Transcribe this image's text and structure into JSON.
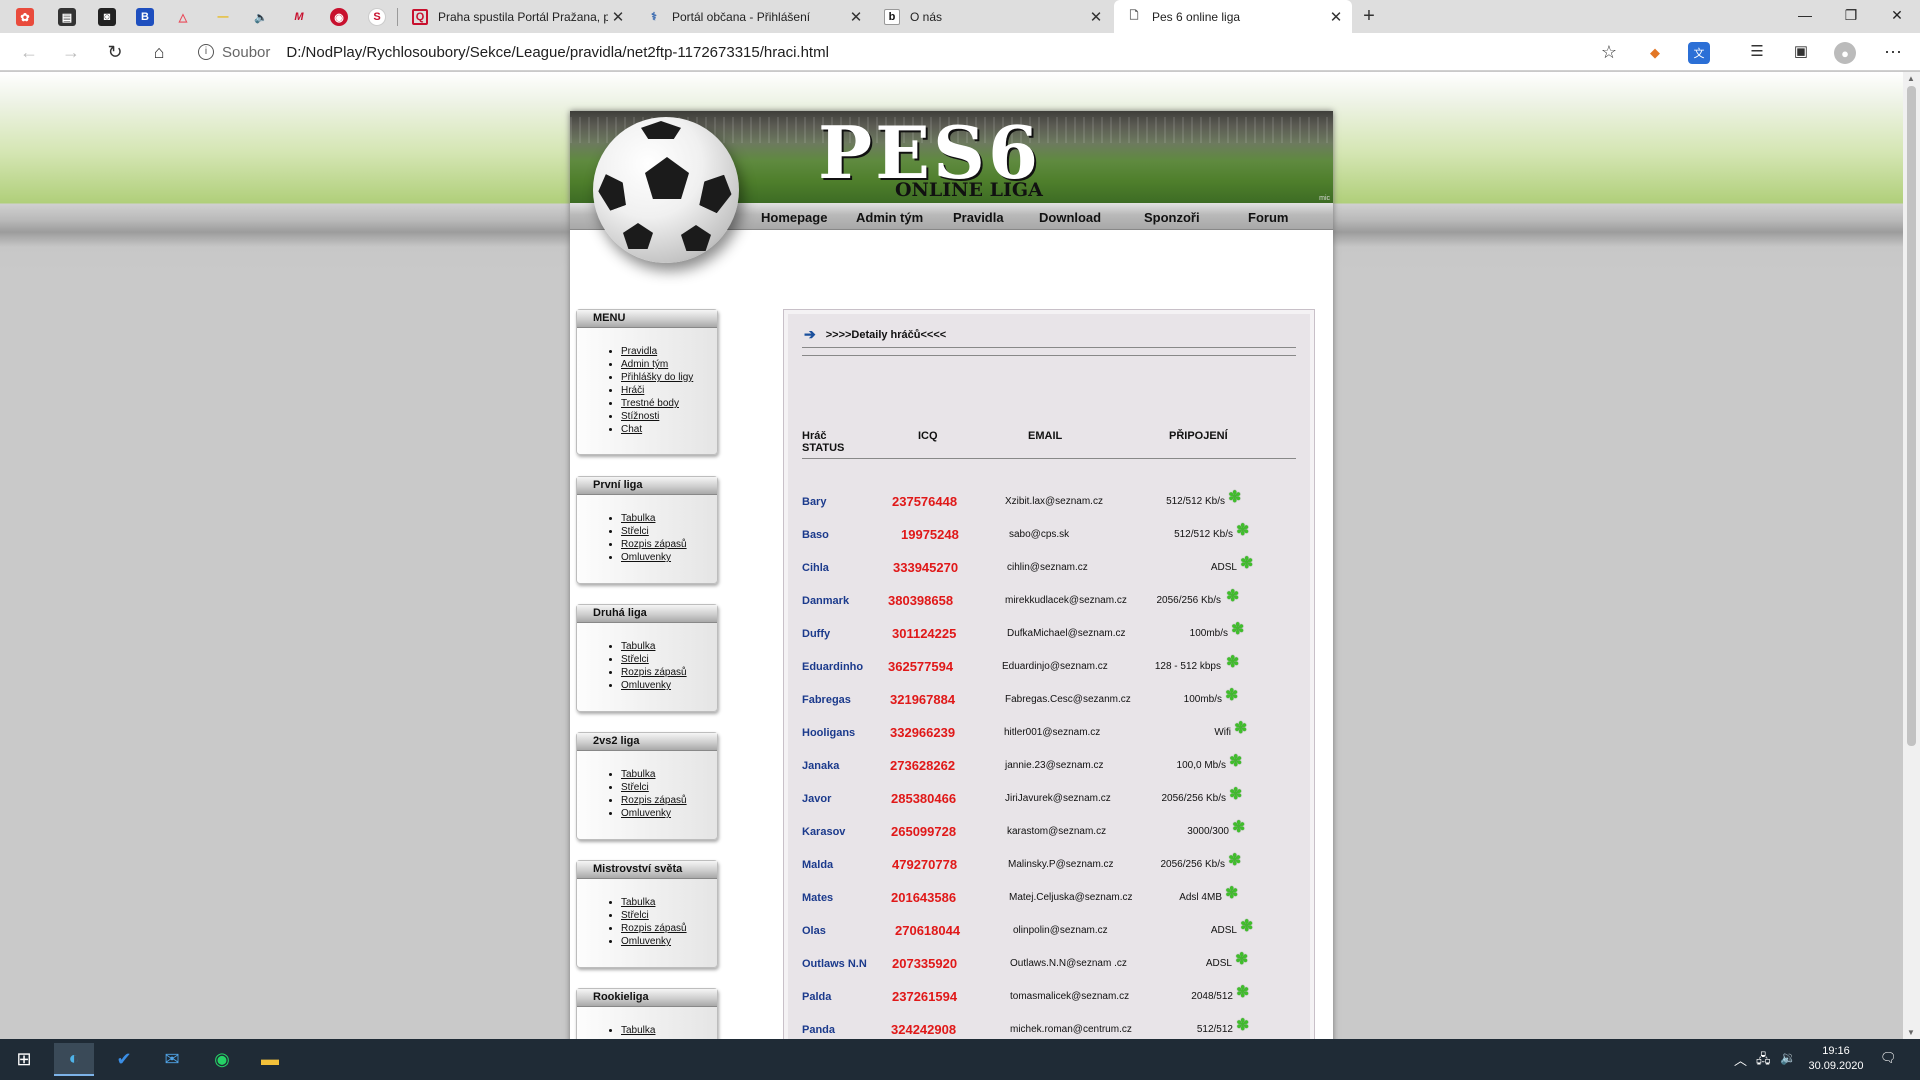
{
  "browser": {
    "tabs": [
      {
        "title": "Praha spustila Portál Pražana, po",
        "favicon": "Q",
        "fav_color": "#c8102e"
      },
      {
        "title": "Portál občana - Přihlášení",
        "favicon": "⚕",
        "fav_color": "#3a6ab0"
      },
      {
        "title": "O nás",
        "favicon": "b",
        "fav_color": "#111"
      },
      {
        "title": "Pes 6 online liga",
        "favicon": "🗋",
        "fav_color": "#555"
      }
    ],
    "address": {
      "scheme_label": "Soubor",
      "url": "D:/NodPlay/Rychlosoubory/Sekce/League/pravidla/net2ftp-1172673315/hraci.html"
    }
  },
  "site": {
    "logo": "PES6",
    "logo_sub": "ONLINE LIGA",
    "logo_mark": "mic",
    "nav": [
      "Homepage",
      "Admin tým",
      "Pravidla",
      "Download",
      "Sponzoři",
      "Forum"
    ]
  },
  "sidebar": [
    {
      "title": "MENU",
      "links": [
        "Pravidla",
        "Admin tým",
        "Přihlášky do ligy",
        "Hráči",
        "Trestné body",
        "Stížnosti",
        "Chat"
      ]
    },
    {
      "title": "První liga",
      "links": [
        "Tabulka",
        "Střelci",
        "Rozpis zápasů",
        "Omluvenky"
      ]
    },
    {
      "title": "Druhá liga",
      "links": [
        "Tabulka",
        "Střelci",
        "Rozpis zápasů",
        "Omluvenky"
      ]
    },
    {
      "title": "2vs2 liga",
      "links": [
        "Tabulka",
        "Střelci",
        "Rozpis zápasů",
        "Omluvenky"
      ]
    },
    {
      "title": "Mistrovství světa",
      "links": [
        "Tabulka",
        "Střelci",
        "Rozpis zápasů",
        "Omluvenky"
      ]
    },
    {
      "title": "Rookieliga",
      "links": [
        "Tabulka"
      ]
    }
  ],
  "content": {
    "title": ">>>>Detaily hráčů<<<<",
    "headers": {
      "player": "Hráč",
      "status": "STATUS",
      "icq": "ICQ",
      "email": "EMAIL",
      "connection": "PŘIPOJENÍ"
    },
    "players": [
      {
        "name": "Bary",
        "icq": "237576448",
        "email": "Xzibit.lax@seznam.cz",
        "conn": "512/512 Kb/s"
      },
      {
        "name": "Baso",
        "icq": "19975248",
        "email": "sabo@cps.sk",
        "conn": "512/512 Kb/s"
      },
      {
        "name": "Cihla",
        "icq": "333945270",
        "email": "cihlin@seznam.cz",
        "conn": "ADSL"
      },
      {
        "name": "Danmark",
        "icq": "380398658",
        "email": "mirekkudlacek@seznam.cz",
        "conn": "2056/256 Kb/s"
      },
      {
        "name": "Duffy",
        "icq": "301124225",
        "email": "DufkaMichael@seznam.cz",
        "conn": "100mb/s"
      },
      {
        "name": "Eduardinho",
        "icq": "362577594",
        "email": "Eduardinjo@seznam.cz",
        "conn": "128 - 512 kbps"
      },
      {
        "name": "Fabregas",
        "icq": "321967884",
        "email": "Fabregas.Cesc@sezanm.cz",
        "conn": "100mb/s"
      },
      {
        "name": "Hooligans",
        "icq": "332966239",
        "email": "hitler001@seznam.cz",
        "conn": "Wifi"
      },
      {
        "name": "Janaka",
        "icq": "273628262",
        "email": "jannie.23@seznam.cz",
        "conn": "100,0 Mb/s"
      },
      {
        "name": "Javor",
        "icq": "285380466",
        "email": "JiriJavurek@seznam.cz",
        "conn": "2056/256 Kb/s"
      },
      {
        "name": "Karasov",
        "icq": "265099728",
        "email": "karastom@seznam.cz",
        "conn": "3000/300"
      },
      {
        "name": "Malda",
        "icq": "479270778",
        "email": "Malinsky.P@seznam.cz",
        "conn": "2056/256 Kb/s"
      },
      {
        "name": "Mates",
        "icq": "201643586",
        "email": "Matej.Celjuska@seznam.cz",
        "conn": "Adsl 4MB"
      },
      {
        "name": "Olas",
        "icq": "270618044",
        "email": "olinpolin@seznam.cz",
        "conn": "ADSL"
      },
      {
        "name": "Outlaws N.N",
        "icq": "207335920",
        "email": "Outlaws.N.N@seznam .cz",
        "conn": "ADSL"
      },
      {
        "name": "Palda",
        "icq": "237261594",
        "email": "tomasmalicek@seznam.cz",
        "conn": "2048/512"
      },
      {
        "name": "Panda",
        "icq": "324242908",
        "email": "michek.roman@centrum.cz",
        "conn": "512/512"
      }
    ]
  },
  "taskbar": {
    "time": "19:16",
    "date": "30.09.2020"
  }
}
